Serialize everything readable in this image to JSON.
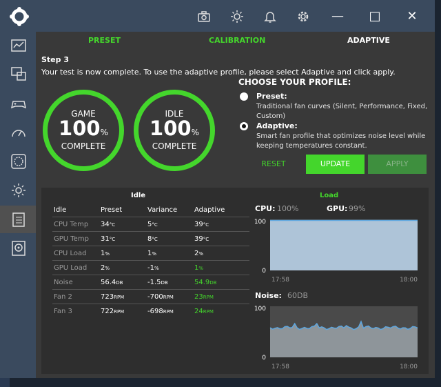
{
  "tabs": [
    {
      "label": "PRESET"
    },
    {
      "label": "CALIBRATION"
    },
    {
      "label": "ADAPTIVE"
    }
  ],
  "step": {
    "title": "Step 3",
    "text": "Your test is now complete. To use the adaptive profile, please select Adaptive and click apply."
  },
  "rings": [
    {
      "label": "GAME",
      "value": "100",
      "unit": "%",
      "status": "COMPLETE"
    },
    {
      "label": "IDLE",
      "value": "100",
      "unit": "%",
      "status": "COMPLETE"
    }
  ],
  "profile": {
    "heading": "CHOOSE YOUR PROFILE:",
    "options": [
      {
        "title": "Preset:",
        "desc": "Traditional fan curves (Silent, Performance, Fixed, Custom)",
        "selected": false
      },
      {
        "title": "Adaptive:",
        "desc": "Smart fan profile that optimizes noise level while keeping temperatures constant.",
        "selected": true
      }
    ]
  },
  "buttons": {
    "reset": "RESET",
    "update": "UPDATE",
    "apply": "APPLY"
  },
  "table": {
    "idle_title": "Idle",
    "load_title": "Load",
    "headers": [
      "Idle",
      "Preset",
      "Variance",
      "Adaptive"
    ],
    "rows": [
      {
        "label": "CPU Temp",
        "preset": "34",
        "preset_unit": "°C",
        "variance": "5",
        "variance_unit": "°C",
        "adaptive": "39",
        "adaptive_unit": "°C",
        "adaptive_green": false
      },
      {
        "label": "GPU Temp",
        "preset": "31",
        "preset_unit": "°C",
        "variance": "8",
        "variance_unit": "°C",
        "adaptive": "39",
        "adaptive_unit": "°C",
        "adaptive_green": false
      },
      {
        "label": "CPU Load",
        "preset": "1",
        "preset_unit": "%",
        "variance": "1",
        "variance_unit": "%",
        "adaptive": "2",
        "adaptive_unit": "%",
        "adaptive_green": false
      },
      {
        "label": "GPU Load",
        "preset": "2",
        "preset_unit": "%",
        "variance": "-1",
        "variance_unit": "%",
        "adaptive": "1",
        "adaptive_unit": "%",
        "adaptive_green": true
      },
      {
        "label": "Noise",
        "preset": "56.4",
        "preset_unit": "DB",
        "variance": "-1.5",
        "variance_unit": "DB",
        "adaptive": "54.9",
        "adaptive_unit": "DB",
        "adaptive_green": true
      },
      {
        "label": "Fan 2",
        "preset": "723",
        "preset_unit": "RPM",
        "variance": "-700",
        "variance_unit": "RPM",
        "adaptive": "23",
        "adaptive_unit": "RPM",
        "adaptive_green": true
      },
      {
        "label": "Fan 3",
        "preset": "722",
        "preset_unit": "RPM",
        "variance": "-698",
        "variance_unit": "RPM",
        "adaptive": "24",
        "adaptive_unit": "RPM",
        "adaptive_green": true
      }
    ]
  },
  "charts": [
    {
      "labels": [
        "CPU:",
        "GPU:"
      ],
      "values": [
        "100%",
        "99%"
      ],
      "y_max": "100",
      "y_min": "0",
      "x_start": "17:58",
      "x_end": "18:00",
      "fill": "#aec4d8",
      "line": "#5ea7e0",
      "level": 0.98
    },
    {
      "labels": [
        "Noise:"
      ],
      "values": [
        "60DB"
      ],
      "y_max": "100",
      "y_min": "0",
      "x_start": "17:58",
      "x_end": "18:00",
      "fill": "#8e959a",
      "line": "#5ea7e0",
      "level": 0.58
    }
  ],
  "colors": {
    "accent": "#44d62c",
    "sidebar": "#3a4a5e",
    "panel": "#2e2e2e"
  }
}
